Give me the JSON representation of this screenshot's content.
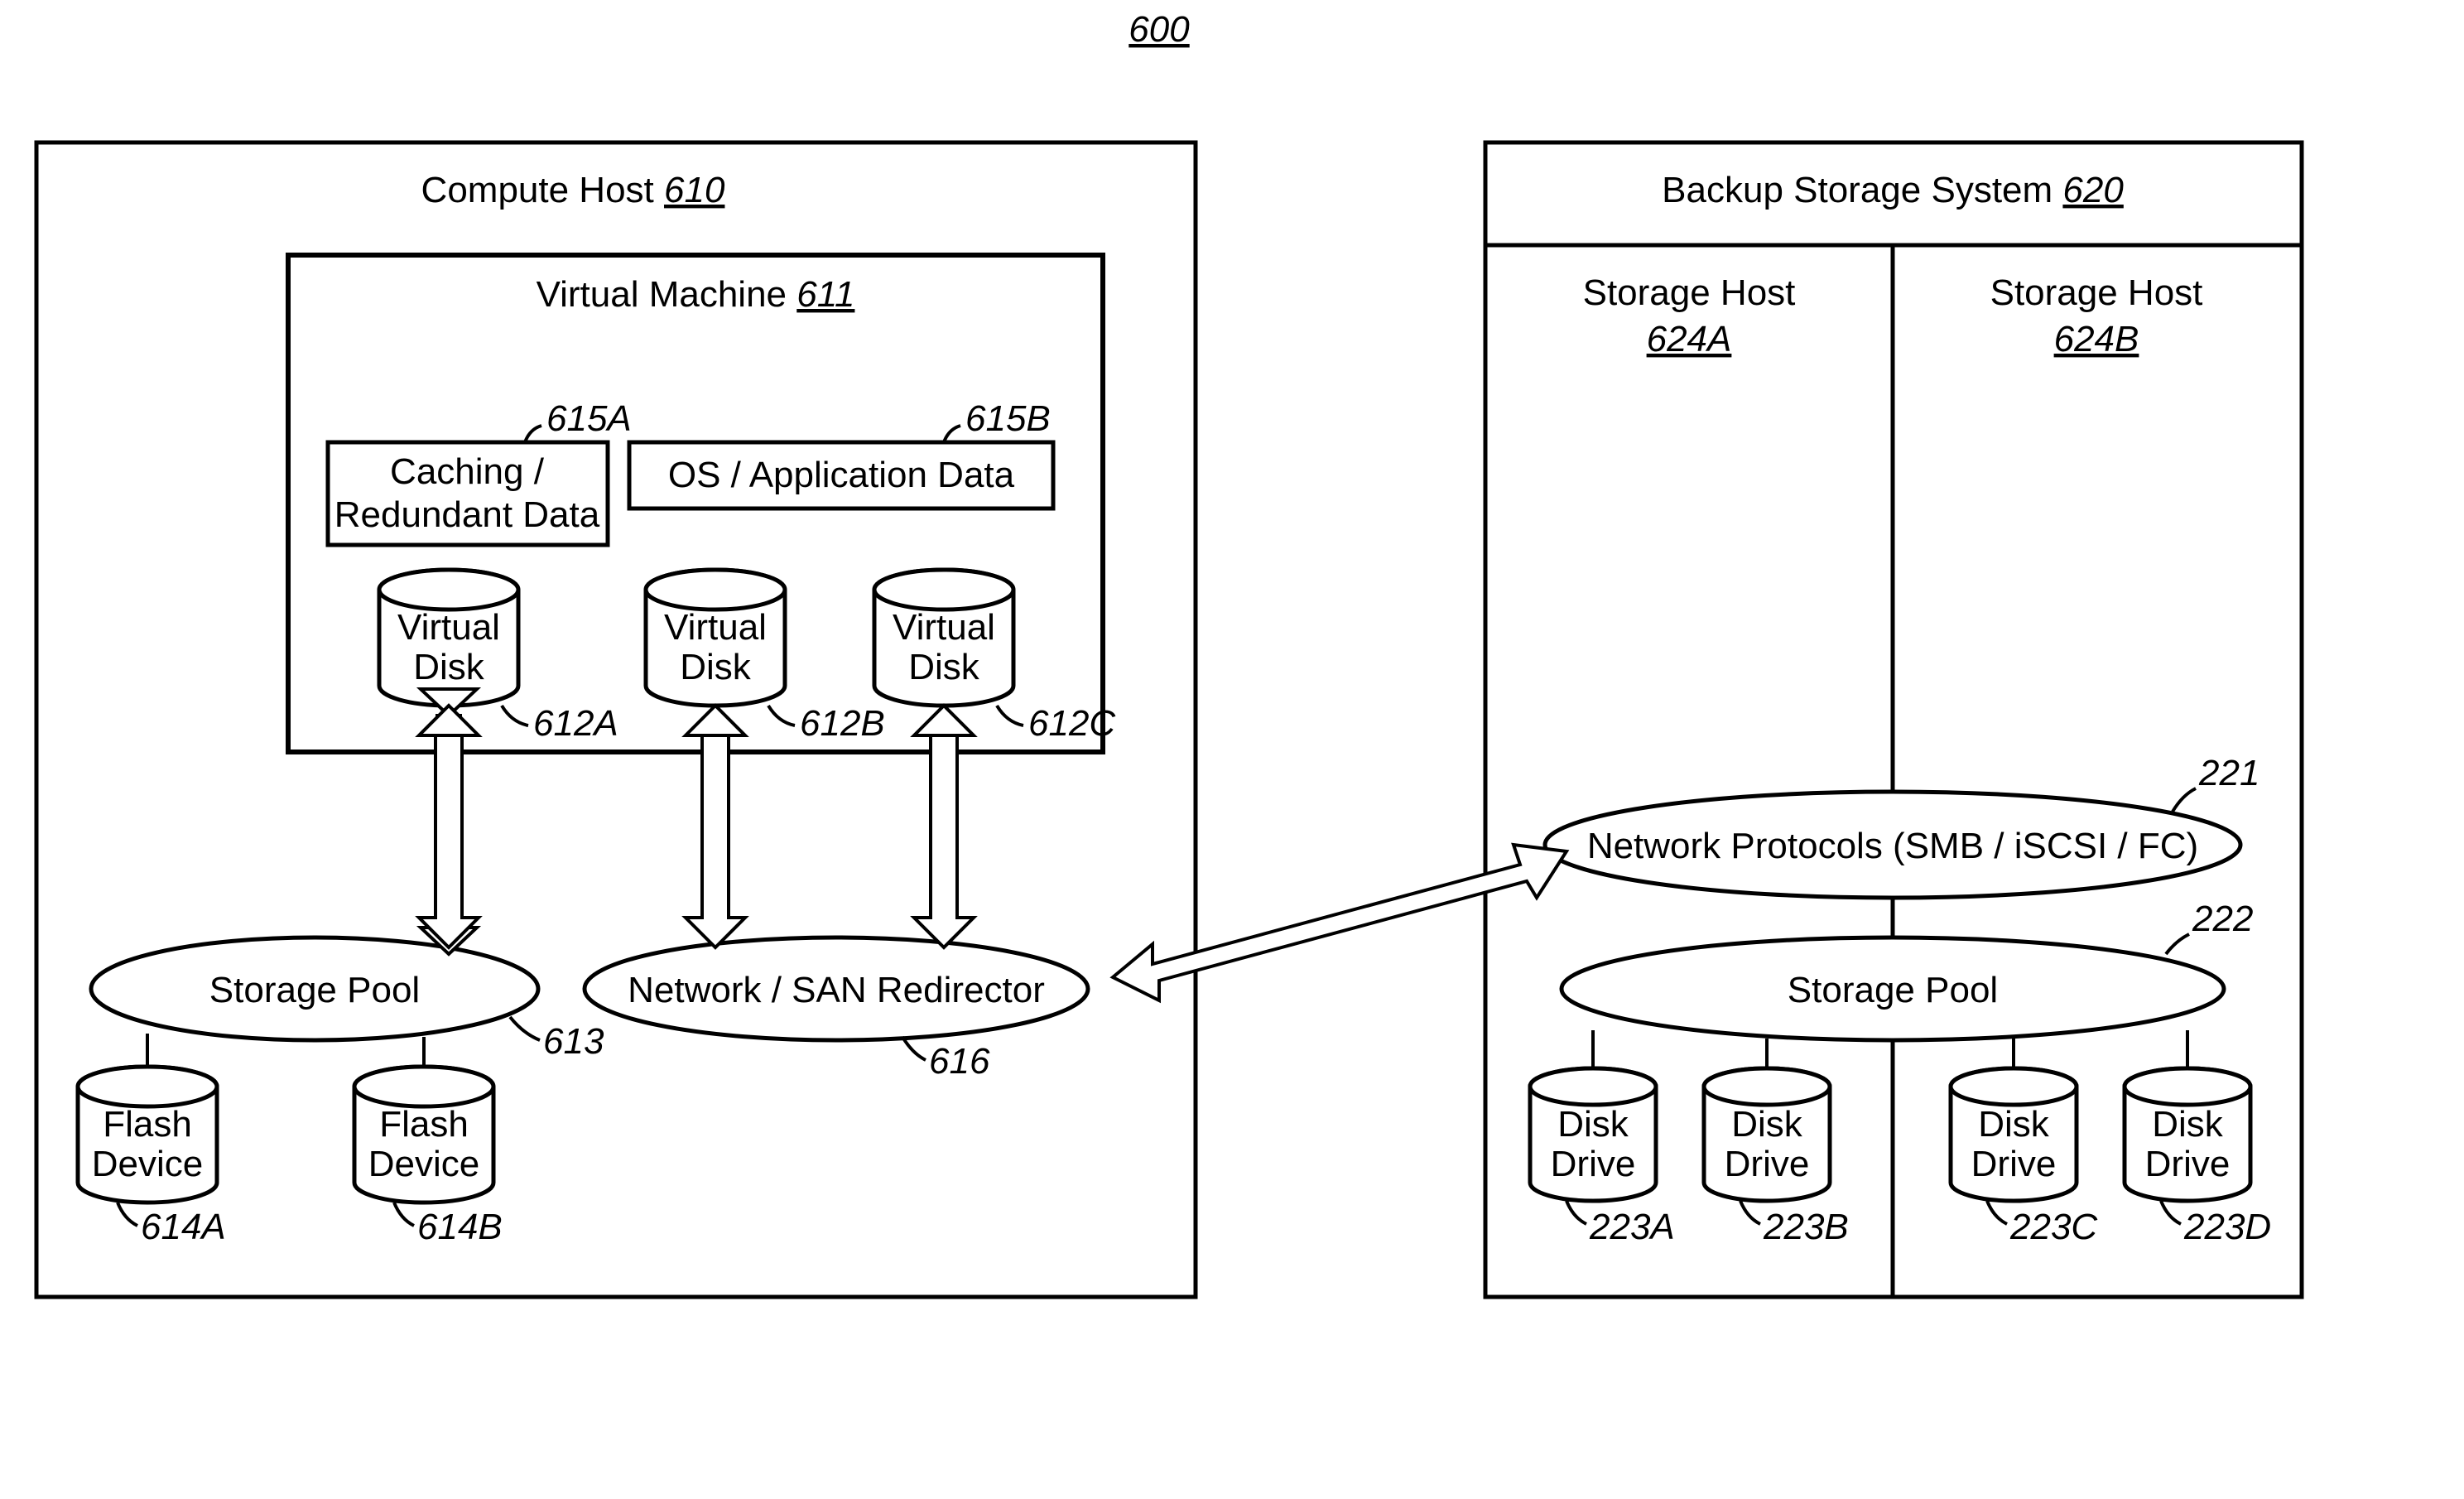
{
  "fig": {
    "num": "600"
  },
  "compute_host": {
    "title": "Compute Host",
    "ref": "610"
  },
  "vm": {
    "title": "Virtual Machine",
    "ref": "611"
  },
  "box_cache": {
    "line1": "Caching /",
    "line2": "Redundant Data",
    "ref": "615A"
  },
  "box_os": {
    "label": "OS / Application Data",
    "ref": "615B"
  },
  "vdiskA": {
    "title": "Virtual",
    "sub": "Disk",
    "ref": "612A"
  },
  "vdiskB": {
    "title": "Virtual",
    "sub": "Disk",
    "ref": "612B"
  },
  "vdiskC": {
    "title": "Virtual",
    "sub": "Disk",
    "ref": "612C"
  },
  "pool_left": {
    "label": "Storage Pool",
    "ref": "613"
  },
  "redirector": {
    "label": "Network / SAN Redirector",
    "ref": "616"
  },
  "flashA": {
    "line1": "Flash",
    "line2": "Device",
    "ref": "614A"
  },
  "flashB": {
    "line1": "Flash",
    "line2": "Device",
    "ref": "614B"
  },
  "backup": {
    "title": "Backup Storage System",
    "ref": "620"
  },
  "shostA": {
    "title": "Storage Host",
    "ref": "624A"
  },
  "shostB": {
    "title": "Storage Host",
    "ref": "624B"
  },
  "netproto": {
    "label": "Network Protocols (SMB / iSCSI / FC)",
    "ref": "221"
  },
  "pool_right": {
    "label": "Storage Pool",
    "ref": "222"
  },
  "ddA": {
    "line1": "Disk",
    "line2": "Drive",
    "ref": "223A"
  },
  "ddB": {
    "line1": "Disk",
    "line2": "Drive",
    "ref": "223B"
  },
  "ddC": {
    "line1": "Disk",
    "line2": "Drive",
    "ref": "223C"
  },
  "ddD": {
    "line1": "Disk",
    "line2": "Drive",
    "ref": "223D"
  }
}
